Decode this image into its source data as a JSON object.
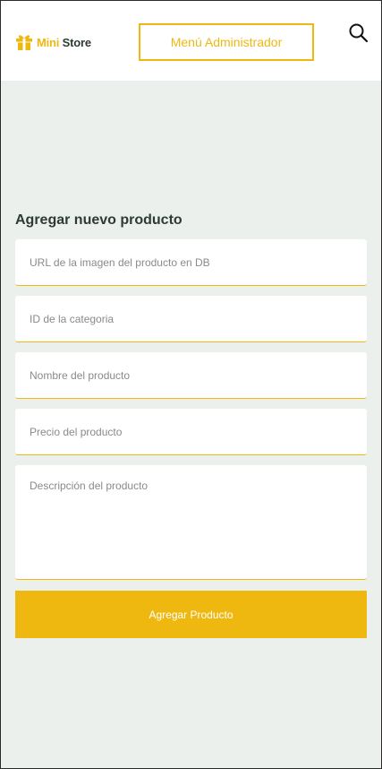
{
  "header": {
    "logo": {
      "icon": "gift-icon",
      "brand_part1": "Mini",
      "brand_part2": "Store"
    },
    "admin_menu_label": "Menú Administrador",
    "search_icon": "search-icon"
  },
  "form": {
    "title": "Agregar nuevo producto",
    "fields": [
      {
        "placeholder": "URL de la imagen del producto en DB",
        "value": ""
      },
      {
        "placeholder": "ID de la categoria",
        "value": ""
      },
      {
        "placeholder": "Nombre del producto",
        "value": ""
      },
      {
        "placeholder": "Precio del producto",
        "value": ""
      },
      {
        "placeholder": "Descripción del producto",
        "value": ""
      }
    ],
    "submit_label": "Agregar Producto"
  },
  "colors": {
    "accent": "#efb810",
    "background": "#ecf0ec",
    "heading": "#2d3b33",
    "placeholder": "#8a8a8a"
  }
}
